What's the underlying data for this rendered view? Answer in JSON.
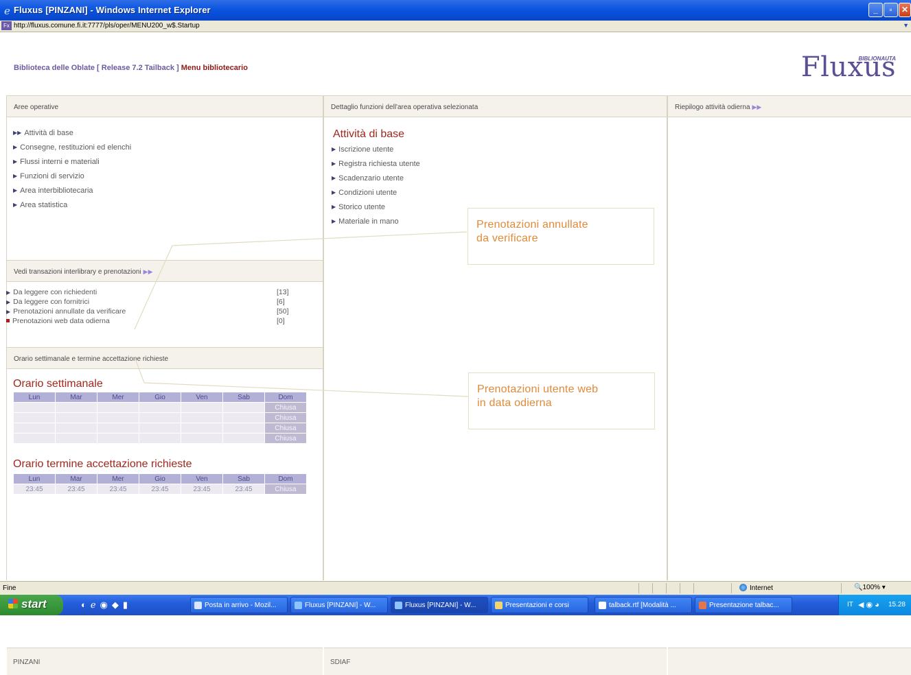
{
  "window": {
    "title": "Fluxus [PINZANI] - Windows Internet Explorer",
    "url": "http://fluxus.comune.fi.it:7777/pls/oper/MENU200_w$.Startup"
  },
  "header": {
    "library": "Biblioteca delle Oblate [ Release 7.2 Tailback ]",
    "menu": "Menu bibliotecario",
    "logo_text": "Fluxus",
    "logo_tag": "BIBLIONAUTA"
  },
  "left": {
    "aree_header": "Aree operative",
    "aree_items": [
      "Attività di base",
      "Consegne, restituzioni ed elenchi",
      "Flussi interni e materiali",
      "Funzioni di servizio",
      "Area interbibliotecaria",
      "Area statistica"
    ],
    "trans_header": "Vedi transazioni interlibrary e prenotazioni",
    "trans_items": [
      {
        "label": "Da leggere con richiedenti",
        "count": "[13]"
      },
      {
        "label": "Da leggere con fornitrici",
        "count": "[6]"
      },
      {
        "label": "Prenotazioni annullate da verificare",
        "count": "[50]"
      },
      {
        "label": "Prenotazioni web data odierna",
        "count": "[0]"
      }
    ],
    "orario_header": "Orario settimanale e termine accettazione richieste",
    "orario_title": "Orario settimanale",
    "days": [
      "Lun",
      "Mar",
      "Mer",
      "Gio",
      "Ven",
      "Sab",
      "Dom"
    ],
    "closed_label": "Chiusa",
    "termine_title": "Orario termine accettazione richieste",
    "termine_times": [
      "23:45",
      "23:45",
      "23:45",
      "23:45",
      "23:45",
      "23:45",
      "Chiusa"
    ],
    "footer": "PINZANI"
  },
  "middle": {
    "header": "Dettaglio funzioni dell'area operativa selezionata",
    "title": "Attività di base",
    "items": [
      "Iscrizione utente",
      "Registra richiesta utente",
      "Scadenzario utente",
      "Condizioni utente",
      "Storico utente",
      "Materiale in mano"
    ],
    "footer": "SDIAF"
  },
  "right": {
    "header": "Riepilogo attività odierna"
  },
  "callouts": {
    "first": [
      "Prenotazioni annullate",
      "da verificare"
    ],
    "second": [
      "Prenotazioni utente web",
      "in data odierna"
    ]
  },
  "statusbar": {
    "status": "Fine",
    "zone": "Internet",
    "zoom": "100%"
  },
  "taskbar": {
    "start": "start",
    "buttons": [
      "Posta in arrivo - Mozil...",
      "Fluxus [PINZANI] - W...",
      "Fluxus [PINZANI] - W...",
      "Presentazioni e corsi",
      "talback.rtf [Modalità ...",
      "Presentazione talbac..."
    ],
    "lang": "IT",
    "clock": "15.28"
  }
}
